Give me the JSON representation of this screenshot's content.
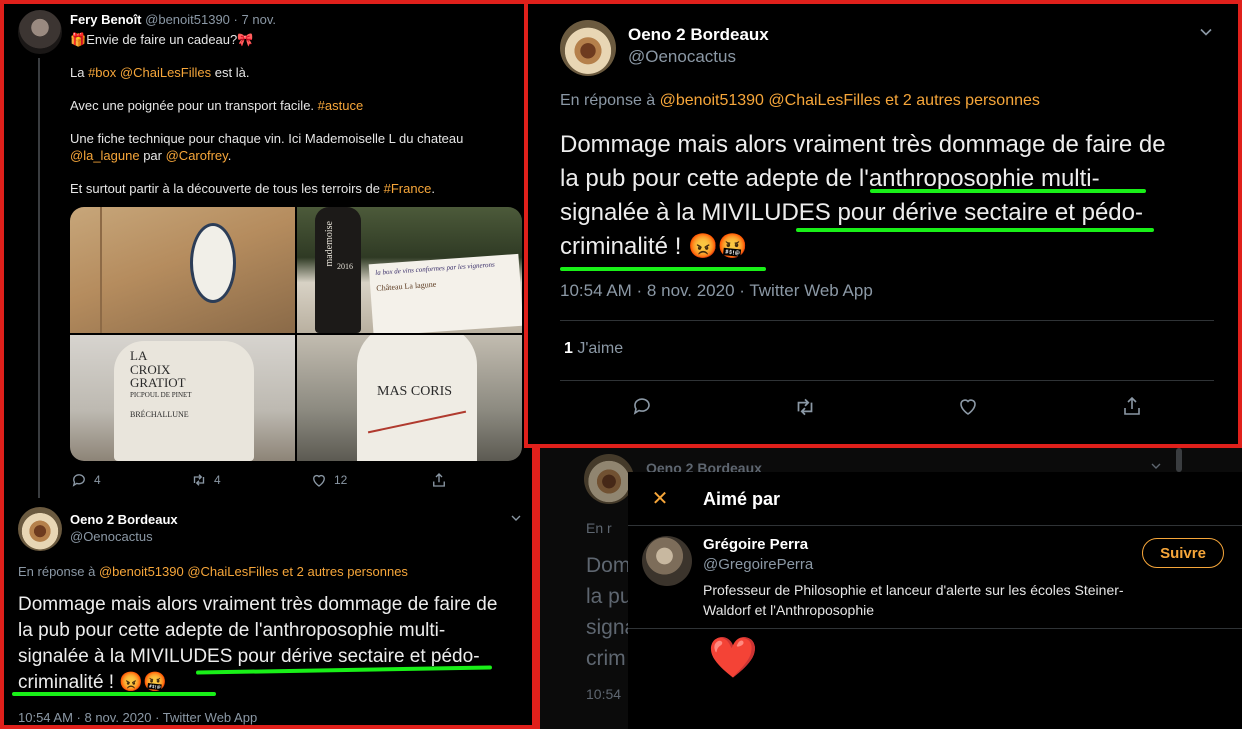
{
  "left": {
    "tweet1": {
      "author_name": "Fery Benoît",
      "author_handle": "@benoit51390",
      "dot": "·",
      "date": "7 nov.",
      "line1_emoji_gift": "🎁",
      "line1_text": "Envie de faire un cadeau?",
      "line1_emoji_ribbon": "🎀",
      "line2_a": "La ",
      "line2_tag_box": "#box",
      "line2_sp": " ",
      "line2_mention": "@ChaiLesFilles",
      "line2_b": " est là.",
      "line3_a": "Avec une poignée pour un transport facile. ",
      "line3_tag": "#astuce",
      "line4_a": "Une fiche technique pour chaque vin. Ici Mademoiselle L du chateau",
      "line5_mention1": "@la_lagune",
      "line5_mid": " par ",
      "line5_mention2": "@Carofrey",
      "line5_end": ".",
      "line6_a": "Et surtout partir à la découverte de tous les terroirs de ",
      "line6_tag": "#France",
      "line6_end": ".",
      "photos": {
        "p2_label": "mademoise",
        "p2_year": "2016",
        "p2_card_title": "la box de vins conformes par les vignerons",
        "p2_card_sub": "Château La lagune",
        "p3_line1": "LA",
        "p3_line2": "CROIX",
        "p3_line3": "GRATIOT",
        "p3_line4": "PICPOUL DE PINET",
        "p3_line5": "BRÉCHALLUNE",
        "p4_line1": "MAS",
        "p4_line2": "CORIS"
      },
      "replies": "4",
      "retweets": "4",
      "likes": "12"
    },
    "tweet2": {
      "author_name": "Oeno 2 Bordeaux",
      "author_handle": "@Oenocactus",
      "reply_prefix": "En réponse à ",
      "reply_mentions": "@benoit51390 @ChaiLesFilles",
      "reply_others": "  et 2 autres personnes",
      "body_line1": "Dommage mais alors vraiment très dommage de faire de",
      "body_line2": "la pub pour cette adepte de l'anthroposophie multi-",
      "body_line3": "signalée à la MIVILUDES pour dérive sectaire et pédo-",
      "body_line4": "criminalité ! 😡🤬",
      "meta": "10:54 AM · 8 nov. 2020 · Twitter Web App"
    }
  },
  "rtop": {
    "author_name": "Oeno 2 Bordeaux",
    "author_handle": "@Oenocactus",
    "reply_prefix": "En réponse à ",
    "reply_mentions": "@benoit51390 @ChaiLesFilles",
    "reply_others": "  et 2 autres personnes",
    "body_line1": "Dommage mais alors vraiment très dommage de faire de",
    "body_line2": "la pub pour cette adepte de l'anthroposophie multi-",
    "body_line3": "signalée à la MIVILUDES pour dérive sectaire et pédo-",
    "body_line4": "criminalité ! 😡🤬",
    "meta": "10:54 AM · 8 nov. 2020 · Twitter Web App",
    "likes_count": "1",
    "likes_label": " J'aime"
  },
  "rbot": {
    "bg_name": "Oeno 2 Bordeaux",
    "bg_reply": "En r",
    "bg_l1": "Dom",
    "bg_l2": "la pu",
    "bg_l3": "signa",
    "bg_l4": "crim",
    "bg_meta": "10:54",
    "modal": {
      "close_glyph": "✕",
      "title": "Aimé par",
      "user_name": "Grégoire Perra",
      "user_handle": "@GregoirePerra",
      "follow_label": "Suivre",
      "bio_line1": "Professeur de Philosophie et lanceur d'alerte sur les écoles Steiner-",
      "bio_line2": "Waldorf et l'Anthroposophie",
      "heart": "❤️"
    }
  },
  "colors": {
    "accent": "#f6a63a",
    "highlight_underline": "#19f018",
    "frame": "#e0201b",
    "muted": "#8b98a5"
  },
  "icons": [
    "reply-icon",
    "retweet-icon",
    "like-icon",
    "share-icon",
    "chevron-down-icon",
    "close-icon",
    "heart-icon"
  ]
}
